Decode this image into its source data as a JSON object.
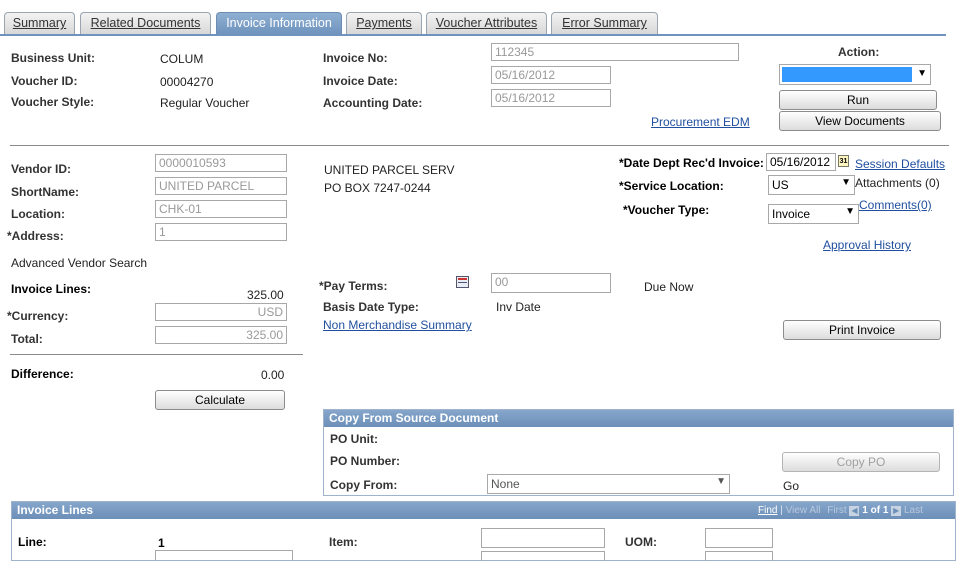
{
  "tabs": [
    {
      "label": "Summary",
      "active": false
    },
    {
      "label": "Related Documents",
      "active": false
    },
    {
      "label": "Invoice Information",
      "active": true
    },
    {
      "label": "Payments",
      "active": false
    },
    {
      "label": "Voucher Attributes",
      "active": false
    },
    {
      "label": "Error Summary",
      "active": false
    }
  ],
  "header": {
    "business_unit_label": "Business Unit:",
    "business_unit": "COLUM",
    "voucher_id_label": "Voucher ID:",
    "voucher_id": "00004270",
    "voucher_style_label": "Voucher Style:",
    "voucher_style": "Regular Voucher",
    "invoice_no_label": "Invoice No:",
    "invoice_no": "112345",
    "invoice_date_label": "Invoice Date:",
    "invoice_date": "05/16/2012",
    "accounting_date_label": "Accounting Date:",
    "accounting_date": "05/16/2012",
    "action_label": "Action:",
    "action_value": "",
    "run_label": "Run",
    "view_documents_label": "View Documents",
    "procurement_edm_link": "Procurement EDM"
  },
  "vendor": {
    "vendor_id_label": "Vendor ID:",
    "vendor_id": "0000010593",
    "shortname_label": "ShortName:",
    "shortname": "UNITED PARCEL",
    "location_label": "Location:",
    "location": "CHK-01",
    "address_label": "*Address:",
    "address": "1",
    "name_line1": "UNITED PARCEL SERV",
    "name_line2": "PO BOX 7247-0244",
    "advanced_search": "Advanced Vendor Search"
  },
  "right_panel": {
    "date_dept_label": "*Date Dept Rec'd Invoice:",
    "date_dept": "05/16/2012",
    "calendar_icon_text": "31",
    "session_defaults_link": "Session Defaults",
    "service_location_label": "*Service Location:",
    "service_location": "US",
    "attachments": "Attachments (0)",
    "voucher_type_label": "*Voucher Type:",
    "voucher_type": "Invoice",
    "comments_link": "Comments(0)",
    "approval_history_link": "Approval History"
  },
  "totals": {
    "invoice_lines_label": "Invoice Lines:",
    "invoice_lines_value": "325.00",
    "currency_label": "*Currency:",
    "currency": "USD",
    "total_label": "Total:",
    "total": "325.00",
    "difference_label": "Difference:",
    "difference": "0.00",
    "calculate_label": "Calculate"
  },
  "payment": {
    "pay_terms_label": "*Pay Terms:",
    "pay_terms": "00",
    "due": "Due Now",
    "basis_date_type_label": "Basis Date Type:",
    "basis_date_type": "Inv Date",
    "non_merch_link": "Non Merchandise Summary",
    "print_invoice_label": "Print Invoice"
  },
  "copy_from": {
    "title": "Copy From Source Document",
    "po_unit_label": "PO Unit:",
    "po_number_label": "PO Number:",
    "copy_from_label": "Copy From:",
    "copy_from_value": "None",
    "copy_po_label": "Copy PO",
    "go_label": "Go"
  },
  "invoice_lines": {
    "title": "Invoice Lines",
    "nav": {
      "find": "Find",
      "sep": "|",
      "view_all": "View All",
      "first": "First",
      "position": "1 of 1",
      "last": "Last"
    },
    "line_label": "Line:",
    "line_value": "1",
    "item_label": "Item:",
    "uom_label": "UOM:"
  }
}
